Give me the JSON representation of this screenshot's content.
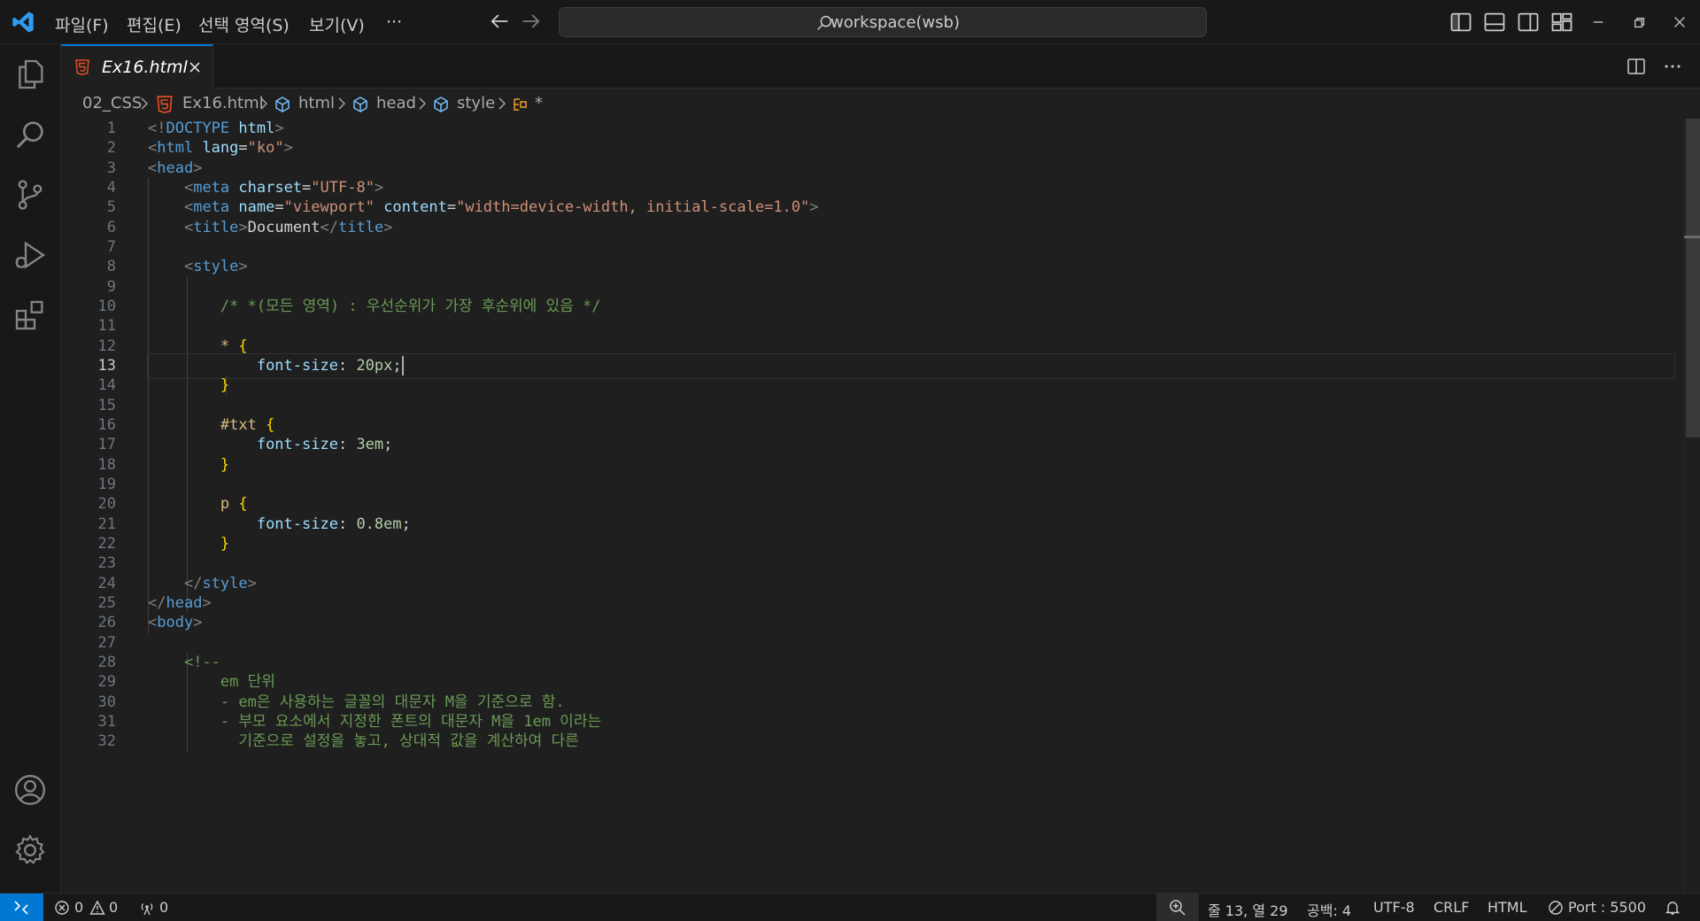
{
  "titlebar": {
    "menus": [
      "파일(F)",
      "편집(E)",
      "선택 영역(S)",
      "보기(V)",
      "···"
    ],
    "search_text": "workspace(wsb)"
  },
  "tabs": [
    {
      "label": "Ex16.html",
      "active": true
    }
  ],
  "breadcrumb": [
    "02_CSS",
    "Ex16.html",
    "html",
    "head",
    "style",
    "*"
  ],
  "editor": {
    "current_line": 13,
    "line_numbers": [
      "1",
      "2",
      "3",
      "4",
      "5",
      "6",
      "7",
      "8",
      "9",
      "10",
      "11",
      "12",
      "13",
      "14",
      "15",
      "16",
      "17",
      "18",
      "19",
      "20",
      "21",
      "22",
      "23",
      "24",
      "25",
      "26",
      "27",
      "28",
      "29",
      "30",
      "31",
      "32"
    ],
    "lines": [
      [
        [
          "<!",
          "punc"
        ],
        [
          "DOCTYPE ",
          "tag"
        ],
        [
          "html",
          "attr"
        ],
        [
          ">",
          "punc"
        ]
      ],
      [
        [
          "<",
          "punc"
        ],
        [
          "html ",
          "tag"
        ],
        [
          "lang",
          "attr"
        ],
        [
          "=",
          "text"
        ],
        [
          "\"ko\"",
          "str"
        ],
        [
          ">",
          "punc"
        ]
      ],
      [
        [
          "<",
          "punc"
        ],
        [
          "head",
          "tag"
        ],
        [
          ">",
          "punc"
        ]
      ],
      [
        [
          "    ",
          "text"
        ],
        [
          "<",
          "punc"
        ],
        [
          "meta ",
          "tag"
        ],
        [
          "charset",
          "attr"
        ],
        [
          "=",
          "text"
        ],
        [
          "\"UTF-8\"",
          "str"
        ],
        [
          ">",
          "punc"
        ]
      ],
      [
        [
          "    ",
          "text"
        ],
        [
          "<",
          "punc"
        ],
        [
          "meta ",
          "tag"
        ],
        [
          "name",
          "attr"
        ],
        [
          "=",
          "text"
        ],
        [
          "\"viewport\" ",
          "str"
        ],
        [
          "content",
          "attr"
        ],
        [
          "=",
          "text"
        ],
        [
          "\"width=device-width, initial-scale=1.0\"",
          "str"
        ],
        [
          ">",
          "punc"
        ]
      ],
      [
        [
          "    ",
          "text"
        ],
        [
          "<",
          "punc"
        ],
        [
          "title",
          "tag"
        ],
        [
          ">",
          "punc"
        ],
        [
          "Document",
          "text"
        ],
        [
          "</",
          "punc"
        ],
        [
          "title",
          "tag"
        ],
        [
          ">",
          "punc"
        ]
      ],
      [],
      [
        [
          "    ",
          "text"
        ],
        [
          "<",
          "punc"
        ],
        [
          "style",
          "tag"
        ],
        [
          ">",
          "punc"
        ]
      ],
      [],
      [
        [
          "        ",
          "text"
        ],
        [
          "/* *(모든 영역) : 우선순위가 가장 후순위에 있음 */",
          "cmt"
        ]
      ],
      [],
      [
        [
          "        ",
          "text"
        ],
        [
          "* ",
          "sel"
        ],
        [
          "{",
          "brace"
        ]
      ],
      [
        [
          "            ",
          "text"
        ],
        [
          "font-size",
          "prop"
        ],
        [
          ": ",
          "text"
        ],
        [
          "20px",
          "num"
        ],
        [
          ";",
          "text"
        ]
      ],
      [
        [
          "        ",
          "text"
        ],
        [
          "}",
          "brace"
        ]
      ],
      [],
      [
        [
          "        ",
          "text"
        ],
        [
          "#txt ",
          "sel"
        ],
        [
          "{",
          "brace"
        ]
      ],
      [
        [
          "            ",
          "text"
        ],
        [
          "font-size",
          "prop"
        ],
        [
          ": ",
          "text"
        ],
        [
          "3em",
          "num"
        ],
        [
          ";",
          "text"
        ]
      ],
      [
        [
          "        ",
          "text"
        ],
        [
          "}",
          "brace"
        ]
      ],
      [],
      [
        [
          "        ",
          "text"
        ],
        [
          "p ",
          "sel"
        ],
        [
          "{",
          "brace"
        ]
      ],
      [
        [
          "            ",
          "text"
        ],
        [
          "font-size",
          "prop"
        ],
        [
          ": ",
          "text"
        ],
        [
          "0.8em",
          "num"
        ],
        [
          ";",
          "text"
        ]
      ],
      [
        [
          "        ",
          "text"
        ],
        [
          "}",
          "brace"
        ]
      ],
      [],
      [
        [
          "    ",
          "text"
        ],
        [
          "</",
          "punc"
        ],
        [
          "style",
          "tag"
        ],
        [
          ">",
          "punc"
        ]
      ],
      [
        [
          "</",
          "punc"
        ],
        [
          "head",
          "tag"
        ],
        [
          ">",
          "punc"
        ]
      ],
      [
        [
          "<",
          "punc"
        ],
        [
          "body",
          "tag"
        ],
        [
          ">",
          "punc"
        ]
      ],
      [],
      [
        [
          "    ",
          "text"
        ],
        [
          "<!--",
          "cmt"
        ]
      ],
      [
        [
          "        ",
          "text"
        ],
        [
          "em 단위",
          "cmt"
        ]
      ],
      [
        [
          "        ",
          "text"
        ],
        [
          "- em은 사용하는 글꼴의 대문자 M을 기준으로 함.",
          "cmt"
        ]
      ],
      [
        [
          "        ",
          "text"
        ],
        [
          "- 부모 요소에서 지정한 폰트의 대문자 M을 1em 이라는",
          "cmt"
        ]
      ],
      [
        [
          "          ",
          "text"
        ],
        [
          "기준으로 설정을 놓고, 상대적 값을 계산하여 다른",
          "cmt"
        ]
      ]
    ]
  },
  "statusbar": {
    "errors": "0",
    "warnings": "0",
    "ports": "0",
    "position": "줄 13, 열 29",
    "indent": "공백: 4",
    "encoding": "UTF-8",
    "eol": "CRLF",
    "language": "HTML",
    "port": "Port : 5500"
  },
  "colors": {
    "accent": "#0078d4",
    "html_file_icon": "#e44d26",
    "symbol_icon": "#75beff"
  }
}
